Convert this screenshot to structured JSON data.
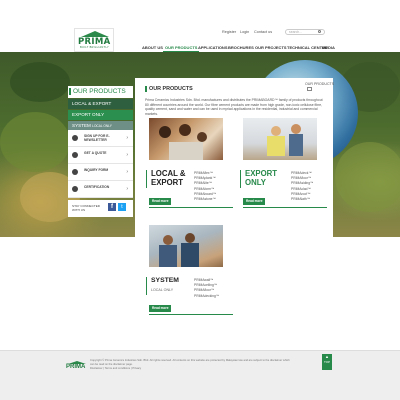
{
  "brand": {
    "logo_text": "PRIMA",
    "logo_tagline": "BUILT BRILLIANTLY",
    "green": "#27894a"
  },
  "header": {
    "links": [
      "Register",
      "Login",
      "Contact us"
    ],
    "search_placeholder": "search..."
  },
  "nav": [
    {
      "label": "ABOUT US",
      "active": false
    },
    {
      "label": "OUR PRODUCTS",
      "active": true
    },
    {
      "label": "APPLICATIONS",
      "active": false
    },
    {
      "label": "BROCHURES",
      "active": false
    },
    {
      "label": "OUR PROJECTS",
      "active": false
    },
    {
      "label": "TECHNICAL CENTER",
      "active": false
    },
    {
      "label": "MEDIA",
      "active": false
    }
  ],
  "sidebar": {
    "heading": "OUR PRODUCTS",
    "tabs": [
      {
        "label": "LOCAL & EXPORT",
        "color": "#2e5f3f"
      },
      {
        "label": "EXPORT ONLY",
        "color": "#2a8f4f"
      },
      {
        "label": "SYSTEM",
        "sub": "LOCAL ONLY",
        "color": "#6e8f86"
      }
    ],
    "items": [
      {
        "label": "SIGN UP FOR E-NEWSLETTER",
        "icon": "mail-icon"
      },
      {
        "label": "GET A QUOTE",
        "icon": "quote-icon"
      },
      {
        "label": "INQUIRY FORM",
        "icon": "inquiry-icon"
      },
      {
        "label": "CERTIFICATION",
        "icon": "certificate-icon"
      }
    ],
    "social_label": "STAY CONNECTED WITH US",
    "facebook": "f",
    "twitter": "t"
  },
  "main": {
    "breadcrumb": "OUR PRODUCTS",
    "title": "OUR PRODUCTS",
    "intro": "Prima Ceramics Industries Sdn. Bhd. manufactures and distributes the PRIMABOARD™ family of products throughout 80 different countries around the world. Our fibre cement products are made from high grade, non-toxic cellulose fibre, quality cement, sand and water and can be used in myriad applications in the residential, industrial and commercial markets.",
    "cards": [
      {
        "title_line1": "LOCAL &",
        "title_line2": "EXPORT",
        "sub": "",
        "products_left": [
          "PRIMAflex™",
          "PRIMAplank™",
          "PRIMAlite™",
          "PRIMAform™",
          "PRIMAboard™",
          "PRIMAstone™",
          "PRIMAfibre™"
        ],
        "products_right": [],
        "button": "Read more"
      },
      {
        "title_line1": "EXPORT",
        "title_line2": "ONLY",
        "sub": "",
        "products_left": [
          "PRIMAdeck™",
          "PRIMAfloor™",
          "PRIMAsiding™",
          "PRIMAclad™",
          "PRIMAroof™",
          "PRIMAlath™",
          "BOXBOARD™"
        ],
        "products_right": [],
        "button": "Read more"
      },
      {
        "title_line1": "SYSTEM",
        "title_line2": "",
        "sub": "LOCAL ONLY",
        "products_left": [
          "PRIMAwall™",
          "PRIMAceiling™",
          "PRIMAfloor™",
          "PRIMAdecking™",
          "PRIMAroof™"
        ],
        "products_right": [],
        "button": "Read more"
      }
    ]
  },
  "footer": {
    "copyright": "Copyright © Prima Ceramics Industries Sdn. Bhd. All rights reserved. All contents on this website are protected by Malaysian law and are subject to the disclaimer which can be read on the disclaimer page.",
    "links": [
      "Disclaimer",
      "Terms and conditions",
      "Privacy"
    ],
    "to_top": "TOP"
  }
}
